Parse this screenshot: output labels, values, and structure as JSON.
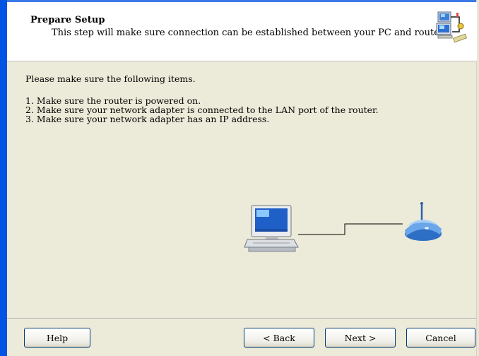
{
  "header": {
    "title": "Prepare Setup",
    "subtitle": "This step will make sure connection can be established between your PC and router",
    "icon": "network-setup-icon"
  },
  "content": {
    "intro": "Please make sure the following items.",
    "items": [
      "1. Make sure the router is powered on.",
      "2. Make sure your network adapter is connected to the LAN port of the router.",
      "3. Make sure your network adapter has an IP address."
    ],
    "illustration": {
      "left_icon": "computer-icon",
      "right_icon": "router-icon"
    }
  },
  "buttons": {
    "help": "Help",
    "back": "< Back",
    "next": "Next >",
    "cancel": "Cancel"
  },
  "colors": {
    "window_frame": "#0054e3",
    "dialog_bg": "#ecead9",
    "header_bg": "#ffffff",
    "button_border": "#003c74"
  }
}
